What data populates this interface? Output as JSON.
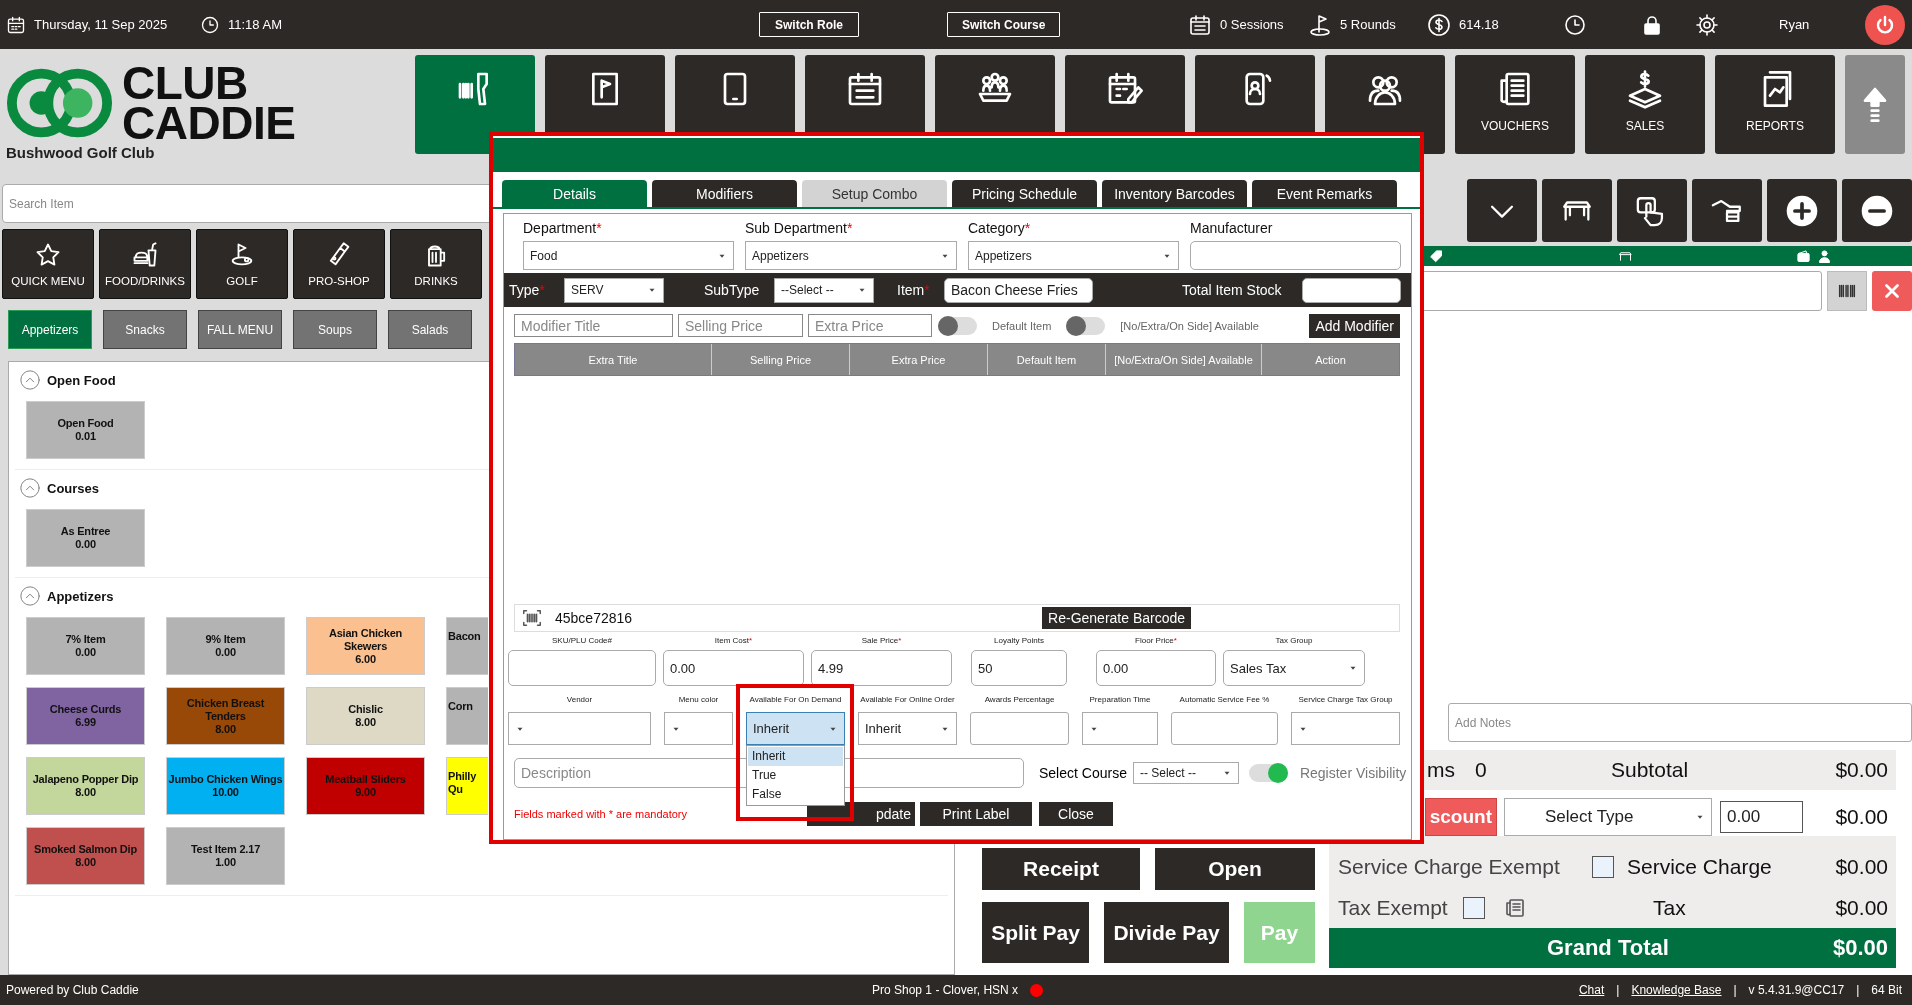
{
  "top_bar": {
    "date": "Thursday,  11 Sep 2025",
    "time": "11:18 AM",
    "buttons": [
      "Switch Role",
      "Switch Course"
    ],
    "sessions": "0 Sessions",
    "rounds": "5 Rounds",
    "balance": "614.18",
    "user": "Ryan"
  },
  "logo": {
    "lines": [
      "CLUB",
      "CADDIE"
    ],
    "club_name": "Bushwood Golf Club"
  },
  "nav": [
    {
      "selected": true
    },
    {
      "selected": false
    },
    {
      "selected": false
    },
    {
      "selected": false
    },
    {
      "selected": false
    },
    {
      "selected": false
    },
    {
      "selected": false
    },
    {
      "selected": false
    },
    {
      "label": "VOUCHERS",
      "selected": false
    },
    {
      "label": "SALES",
      "selected": false
    },
    {
      "label": "REPORTS",
      "selected": false
    }
  ],
  "menu": {
    "search": {
      "placeholder": "Search Item"
    },
    "categories": [
      "QUICK MENU",
      "FOOD/DRINKS",
      "GOLF",
      "PRO-SHOP",
      "DRINKS"
    ],
    "subcategories": [
      {
        "label": "Appetizers",
        "selected": true
      },
      {
        "label": "Snacks",
        "selected": false
      },
      {
        "label": "FALL MENU",
        "selected": false
      },
      {
        "label": "Soups",
        "selected": false
      },
      {
        "label": "Salads",
        "selected": false
      }
    ],
    "sections": [
      {
        "title": "Open Food",
        "expanded": true,
        "items": [
          {
            "name": "Open Food",
            "price": "0.01",
            "color": "#b3b3b3"
          }
        ]
      },
      {
        "title": "Courses",
        "expanded": true,
        "items": [
          {
            "name": "As Entree",
            "price": "0.00",
            "color": "#b3b3b3"
          }
        ]
      },
      {
        "title": "Appetizers",
        "expanded": true,
        "items": [
          {
            "name": "7% Item",
            "price": "0.00",
            "color": "#b3b3b3"
          },
          {
            "name": "9% Item",
            "price": "0.00",
            "color": "#b3b3b3"
          },
          {
            "name": "Asian Chicken Skewers",
            "price": "6.00",
            "color": "#fac090"
          },
          {
            "name": "Bacon",
            "color": "#b3b3b3"
          },
          {
            "name": "Cheese Curds",
            "price": "6.99",
            "color": "#8064a2"
          },
          {
            "name": "Chicken Breast Tenders",
            "price": "8.00",
            "color": "#984807"
          },
          {
            "name": "Chislic",
            "price": "8.00",
            "color": "#ddd9c4"
          },
          {
            "name": "Corn",
            "color": "#b3b3b3"
          },
          {
            "name": "Jalapeno Popper Dip",
            "price": "8.00",
            "color": "#c3d69b"
          },
          {
            "name": "Jumbo Chicken Wings",
            "price": "10.00",
            "color": "#00b0f0"
          },
          {
            "name": "Meatball Sliders",
            "price": "9.00",
            "color": "#c00000"
          },
          {
            "name": "Philly Qu",
            "color": "#ffff00"
          },
          {
            "name": "Smoked Salmon Dip",
            "price": "8.00",
            "color": "#c0504d"
          },
          {
            "name": "Test Item 2.17",
            "price": "1.00",
            "color": "#b3b3b3"
          }
        ]
      }
    ]
  },
  "cart": {
    "notes": {
      "placeholder": "Add Notes"
    },
    "totals": {
      "items_label": "ms",
      "items_count": "0",
      "subtotal_label": "Subtotal",
      "subtotal": "$0.00",
      "discount_button": "scount",
      "discount_type": "Select Type",
      "discount_amount": "0.00",
      "discount": "$0.00",
      "service_exempt": {
        "label": "Service Charge Exempt",
        "checked": false
      },
      "service_label": "Service Charge",
      "service": "$0.00",
      "tax_exempt": {
        "label": "Tax Exempt",
        "checked": false
      },
      "tax_label": "Tax",
      "tax": "$0.00",
      "grand_label": "Grand Total",
      "grand": "$0.00"
    },
    "actions": [
      {
        "label": "Receipt",
        "kind": "action"
      },
      {
        "label": "Open",
        "kind": "action"
      },
      {
        "label": "Split Pay",
        "kind": "action"
      },
      {
        "label": "Divide Pay",
        "kind": "action"
      },
      {
        "label": "Pay",
        "kind": "pay"
      }
    ]
  },
  "modal": {
    "tabs": [
      {
        "label": "Details",
        "selected": true,
        "disabled": false
      },
      {
        "label": "Modifiers",
        "selected": false,
        "disabled": false
      },
      {
        "label": "Setup Combo",
        "selected": false,
        "disabled": true
      },
      {
        "label": "Pricing Schedule",
        "selected": false,
        "disabled": false
      },
      {
        "label": "Inventory Barcodes",
        "selected": false,
        "disabled": false
      },
      {
        "label": "Event Remarks",
        "selected": false,
        "disabled": false
      }
    ],
    "top_fields": [
      {
        "label": "Department",
        "mark": "*",
        "kind": "select",
        "value": "Food"
      },
      {
        "label": "Sub Department",
        "mark": "*",
        "kind": "select",
        "value": "Appetizers"
      },
      {
        "label": "Category",
        "mark": "*",
        "kind": "select",
        "value": "Appetizers"
      },
      {
        "label": "Manufacturer",
        "kind": "input"
      }
    ],
    "type_bar": {
      "type": {
        "label": "Type",
        "mark": "*",
        "value": "SERV"
      },
      "subtype": {
        "label": "SubType",
        "value": "--Select --"
      },
      "item": {
        "label": "Item",
        "mark": "*",
        "value": "Bacon Cheese Fries"
      },
      "stock": {
        "label": "Total Item Stock"
      }
    },
    "modifier_form": {
      "placeholders": [
        "Modifier Title",
        "Selling Price",
        "Extra Price"
      ],
      "toggles": [
        {
          "label": "Default Item",
          "on": false
        },
        {
          "label": "[No/Extra/On Side] Available",
          "on": false
        }
      ],
      "button": "Add Modifier"
    },
    "modifier_table": {
      "columns": [
        "Extra Title",
        "Selling Price",
        "Extra Price",
        "Default Item",
        "[No/Extra/On Side] Available",
        "Action"
      ]
    },
    "barcode": {
      "value": "45bce72816",
      "button": "Re-Generate Barcode"
    },
    "price_fields": [
      {
        "label": "SKU/PLU Code#",
        "kind": "input"
      },
      {
        "label": "Item Cost",
        "mark": "*",
        "kind": "input",
        "value": "0.00"
      },
      {
        "label": "Sale Price",
        "mark": "*",
        "kind": "input",
        "value": "4.99"
      },
      {
        "label": "Loyalty Points",
        "kind": "input",
        "value": "50"
      },
      {
        "label": "Floor Price",
        "mark": "*",
        "kind": "input",
        "value": "0.00"
      },
      {
        "label": "Tax Group",
        "kind": "select",
        "value": "Sales Tax"
      }
    ],
    "option_fields": [
      {
        "label": "Vendor",
        "kind": "select"
      },
      {
        "label": "Menu color",
        "kind": "select"
      },
      {
        "label": "Available For On Demand",
        "kind": "select",
        "value": "Inherit",
        "expanded": true,
        "options": [
          {
            "label": "Inherit",
            "selected": true
          },
          {
            "label": "True",
            "selected": false
          },
          {
            "label": "False",
            "selected": false
          }
        ]
      },
      {
        "label": "Available For Online Order",
        "kind": "select",
        "value": "Inherit"
      },
      {
        "label": "Awards Percentage",
        "kind": "input"
      },
      {
        "label": "Preparation Time",
        "kind": "select"
      },
      {
        "label": "Automatic Service Fee %",
        "kind": "input"
      },
      {
        "label": "Service Charge Tax Group",
        "kind": "select"
      }
    ],
    "description": {
      "placeholder": "Description"
    },
    "course": {
      "label": "Select Course",
      "value": "-- Select --"
    },
    "register_visibility": {
      "label": "Register Visibility",
      "on": true
    },
    "note": "Fields marked with * are mandatory",
    "buttons": [
      "pdate",
      "Print Label",
      "Close"
    ]
  },
  "status_bar": {
    "left": "Powered by Club Caddie",
    "device": {
      "label": "Pro Shop 1 - Clover, HSN x",
      "color": "#ff0000"
    },
    "links": [
      {
        "text": "Chat",
        "kind": "link"
      },
      {
        "text": "|",
        "kind": "separator"
      },
      {
        "text": "Knowledge Base",
        "kind": "link"
      },
      {
        "text": "|",
        "kind": "separator"
      },
      {
        "text": "v 5.4.31.9@CC17",
        "kind": "text"
      },
      {
        "text": "|",
        "kind": "separator"
      },
      {
        "text": "64 Bit",
        "kind": "text"
      }
    ]
  }
}
